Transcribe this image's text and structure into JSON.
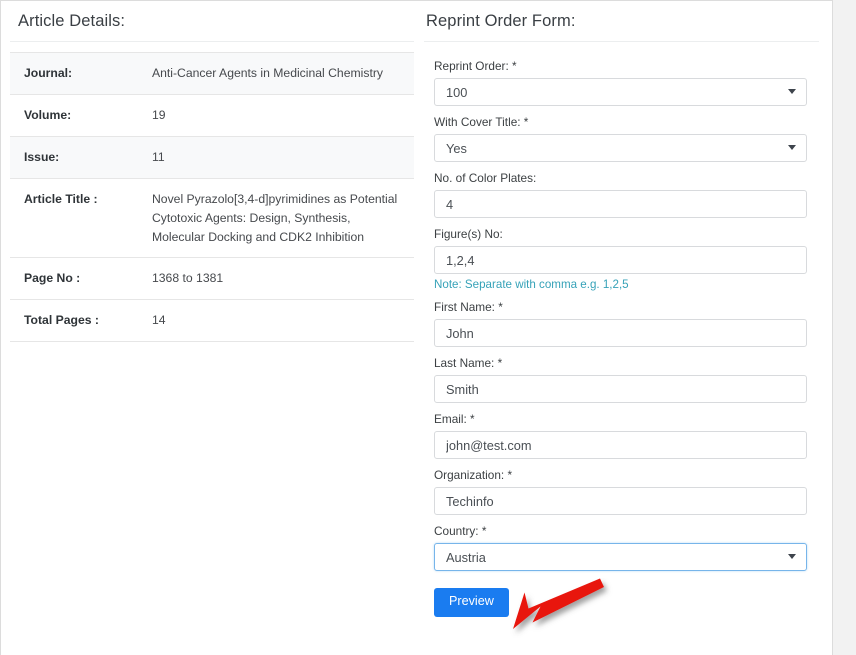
{
  "article_details": {
    "heading": "Article Details:",
    "rows": [
      {
        "key": "Journal:",
        "value": "Anti-Cancer Agents in Medicinal Chemistry"
      },
      {
        "key": "Volume:",
        "value": "19"
      },
      {
        "key": "Issue:",
        "value": "11"
      },
      {
        "key": "Article Title :",
        "value": "Novel Pyrazolo[3,4-d]pyrimidines as Potential Cytotoxic Agents: Design, Synthesis, Molecular Docking and CDK2 Inhibition"
      },
      {
        "key": "Page No :",
        "value": "1368 to 1381"
      },
      {
        "key": "Total Pages :",
        "value": "14"
      }
    ]
  },
  "reprint_form": {
    "heading": "Reprint Order Form:",
    "fields": {
      "reprint_order": {
        "label": "Reprint Order: *",
        "value": "100"
      },
      "with_cover_title": {
        "label": "With Cover Title: *",
        "value": "Yes"
      },
      "color_plates": {
        "label": "No. of Color Plates:",
        "value": "4"
      },
      "figures_no": {
        "label": "Figure(s) No:",
        "value": "1,2,4",
        "note": "Note: Separate with comma e.g. 1,2,5"
      },
      "first_name": {
        "label": "First Name: *",
        "value": "John"
      },
      "last_name": {
        "label": "Last Name: *",
        "value": "Smith"
      },
      "email": {
        "label": "Email: *",
        "value": "john@test.com"
      },
      "organization": {
        "label": "Organization: *",
        "value": "Techinfo"
      },
      "country": {
        "label": "Country: *",
        "value": "Austria"
      }
    },
    "submit_label": "Preview"
  },
  "annotation": {
    "arrow_color": "#e8140c",
    "target": "Preview"
  },
  "theme": {
    "accent_blue": "#1a7cf0",
    "note_teal": "#36a2b8",
    "focus_border": "#77b5ea",
    "stripe_bg": "#f8f9fa",
    "page_bg": "#f2f2f2"
  }
}
